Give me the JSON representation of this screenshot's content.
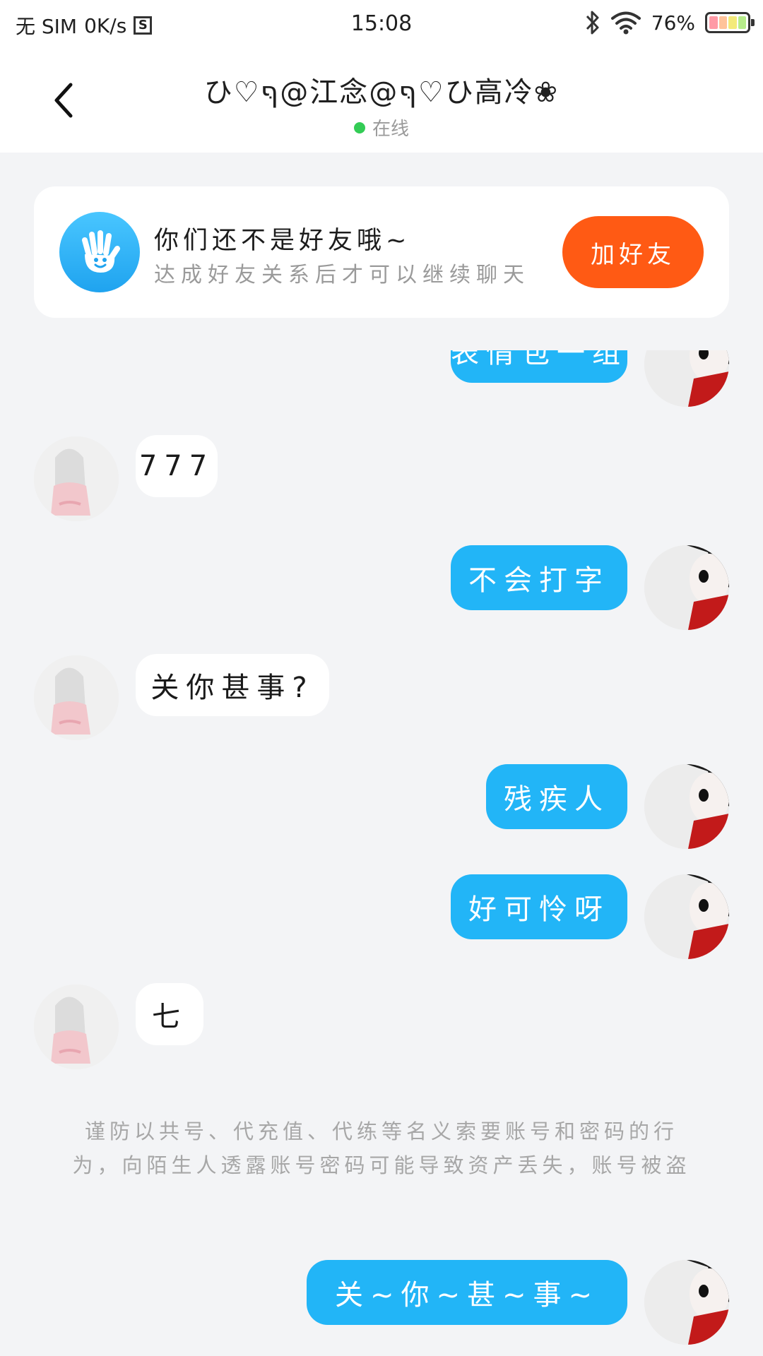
{
  "status_bar": {
    "carrier": "无 SIM",
    "speed": "0K/s",
    "sim_icon": "S",
    "time": "15:08",
    "battery": "76%",
    "icons": [
      "bluetooth-icon",
      "wifi-icon",
      "battery-icon"
    ]
  },
  "header": {
    "title": "ひ♡ףּ@江念@ףּ♡ひ高冷❀",
    "status": "在线",
    "status_color": "#33cc55"
  },
  "friend_card": {
    "title": "你们还不是好友哦~",
    "subtitle": "达成好友关系后才可以继续聊天",
    "button": "加好友",
    "button_color": "#ff5a14",
    "icon": "waving-hand-icon"
  },
  "messages": [
    {
      "from": "me",
      "text": "表情包一组",
      "partial": true
    },
    {
      "from": "them",
      "text": "777"
    },
    {
      "from": "me",
      "text": "不会打字"
    },
    {
      "from": "them",
      "text": "关你甚事?"
    },
    {
      "from": "me",
      "text": "残疾人"
    },
    {
      "from": "me",
      "text": "好可怜呀"
    },
    {
      "from": "them",
      "text": "七"
    },
    {
      "from": "me",
      "text": "关~你~甚~事~"
    }
  ],
  "notice": "谨防以共号、代充值、代练等名义索要账号和密码的行为，向陌生人透露账号密码可能导致资产丢失，账号被盗",
  "colors": {
    "my_bubble": "#22b5f7",
    "their_bubble": "#ffffff",
    "background": "#f3f4f6"
  }
}
